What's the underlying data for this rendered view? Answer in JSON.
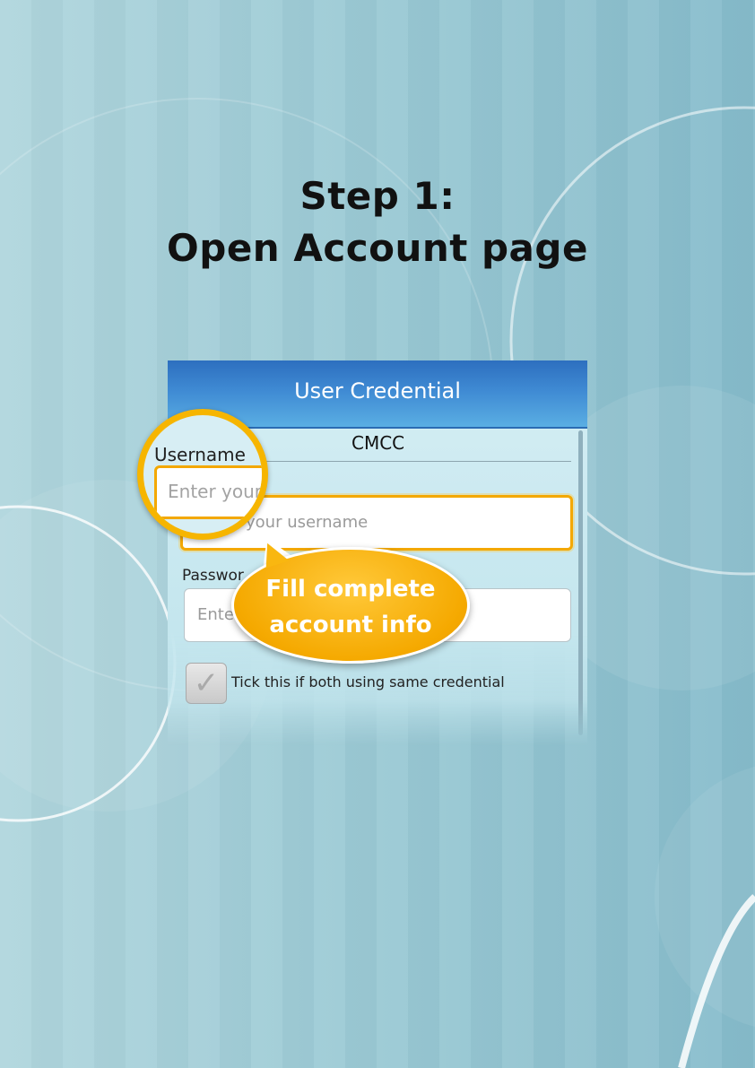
{
  "heading": {
    "line1": "Step 1:",
    "line2": "Open Account page"
  },
  "screen": {
    "title": "User Credential",
    "provider": "CMCC",
    "username_label": "Username",
    "username_placeholder": "your username",
    "password_label": "Passwor",
    "password_placeholder": "Ente",
    "checkbox_label": "Tick this if both using same credential"
  },
  "magnifier": {
    "label": "Username",
    "placeholder": "Enter your"
  },
  "callout": {
    "line1": "Fill complete",
    "line2": "account info"
  },
  "colors": {
    "accent": "#f5a900",
    "titlebar": "#3f8ad3"
  }
}
